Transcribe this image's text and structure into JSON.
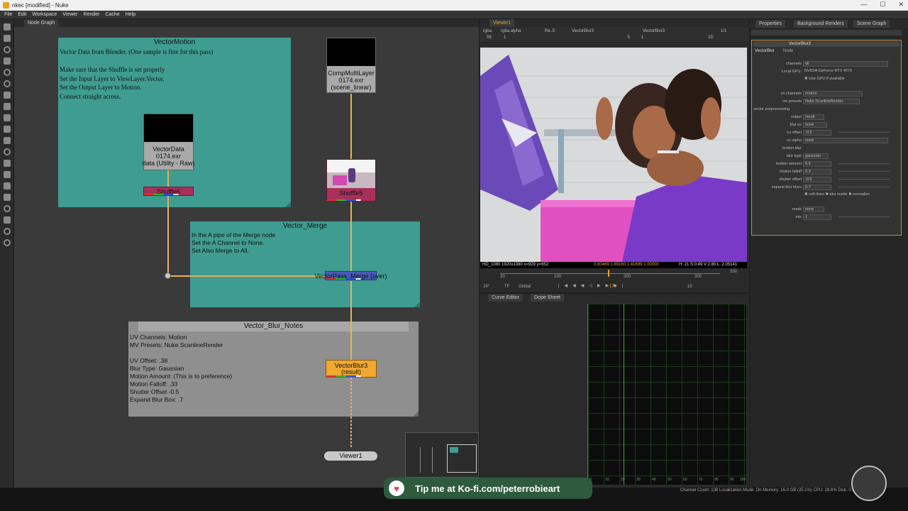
{
  "window": {
    "title": "nkec [modified] - Nuke",
    "buttons": [
      "—",
      "☐",
      "✕"
    ]
  },
  "menu": [
    "File",
    "Edit",
    "Workspace",
    "Viewer",
    "Render",
    "Cache",
    "Help"
  ],
  "node_graph": {
    "tab": "Node Graph",
    "backdrops": {
      "vector_motion": {
        "title": "VectorMotion",
        "text": "Vector Data from Blender. (One sample is fine for this pass)\n\nMake sure that the Shuffle is set properly\nSet the Input Layer to ViewLayer.Vector.\nSet the Output Layer to Motion.\nConnect straight across."
      },
      "vector_merge": {
        "title": "Vector_Merge",
        "text": "In the A pipe of the Merge node\nSet the A Channel to None.\nSet Also Merge to All."
      },
      "notes": {
        "title": "Vector_Blur_Notes",
        "text": "UV Channels: Motion\nMV Presets: Nuke ScanlineRender\n\nUV Offset: .38\nBlur Type: Gaussian\nMotion Amount: (This is to preference)\nMotion Falloff: .33\nShutter Offset -0.5\nExpand Blur Box: .7"
      }
    },
    "nodes": {
      "vector_data": {
        "line1": "VectorData",
        "line2": "0174.exr",
        "line3": "data (Utility - Raw)"
      },
      "shuffle6": {
        "label": "Shuffle6"
      },
      "comp_multilayer": {
        "line1": "CompMultiLayer",
        "line2": "0174.exr",
        "line3": "(scene_linear)"
      },
      "shuffle5": {
        "label": "Shuffle5"
      },
      "merge": {
        "label": "VectorPass_Merge (over)"
      },
      "blur": {
        "line1": "VectorBlur3",
        "line2": "(result)"
      },
      "viewer": {
        "label": "Viewer1"
      }
    }
  },
  "viewer": {
    "tab": "Viewer1",
    "controls": {
      "channels": "rgba",
      "alpha": "rgba.alpha",
      "reset": "Re..5",
      "node": "VectorBlur3",
      "node2": "VectorBlur3",
      "frame": "f/8",
      "gain": "1",
      "value": "1",
      "scale": "1/1",
      "mode": "2D",
      "s": "S",
      "one": "1"
    },
    "status": "HD_1080 1920x1080  x=929 y=552",
    "status_values": "0.80469  1.89160  1.41699  1.00000",
    "status_right": "H: 21 S:0.49 V:2.80  L: 2.05141",
    "timeline": {
      "fps": "24*",
      "tf": "TF",
      "global": "Global",
      "frame": "174",
      "ticks": [
        "20",
        "100",
        "200",
        "300"
      ],
      "end": "330",
      "step": "10"
    }
  },
  "curve_editor": {
    "tabs": [
      "Curve Editor",
      "Dope Sheet"
    ],
    "x_ticks": [
      "0",
      "10",
      "20",
      "30",
      "40",
      "50",
      "60",
      "70",
      "80",
      "90",
      "100"
    ]
  },
  "properties": {
    "tabs": [
      "Properties",
      "Background Renders",
      "Scene Graph"
    ],
    "node_name": "VectorBlur3",
    "subtabs": [
      "VectorBlur",
      "Node"
    ],
    "rows": [
      {
        "label": "channels",
        "value": "all"
      },
      {
        "label": "Local GPU:",
        "value": "NVIDIA GeForce RTX 4070"
      },
      {
        "label": "",
        "value": "✖ Use GPU if available"
      },
      {
        "label": "uv channels",
        "value": "motion"
      },
      {
        "label": "mv presets",
        "value": "Nuke ScanlineRender"
      },
      {
        "label": "vector preprocessing",
        "value": ""
      },
      {
        "label": "output",
        "value": "result"
      },
      {
        "label": "blur uv",
        "value": "none"
      },
      {
        "label": "uv offset",
        "value": "-0.5"
      },
      {
        "label": "uv alpha",
        "value": "none"
      },
      {
        "label": "motion blur",
        "value": ""
      },
      {
        "label": "blur type",
        "value": "gaussian"
      },
      {
        "label": "motion amount",
        "value": "0.6"
      },
      {
        "label": "motion falloff",
        "value": "0.3"
      },
      {
        "label": "shutter offset",
        "value": "-0.5"
      },
      {
        "label": "expand blur bbox",
        "value": "0.7"
      },
      {
        "label": "",
        "value": "✖ soft lines  ✖ blur inside  ✖ normalize"
      },
      {
        "label": "mask",
        "value": "none"
      },
      {
        "label": "mix",
        "value": "1"
      }
    ]
  },
  "statusbar": {
    "text": "Channel Count: 138  Localization Mode: On  Memory: 16.0 GB (25.1%)  CPU: 28.6%  Disk: 0.0 MB/s",
    "kofi": "Tip me at Ko-fi.com/peterrobieart"
  }
}
